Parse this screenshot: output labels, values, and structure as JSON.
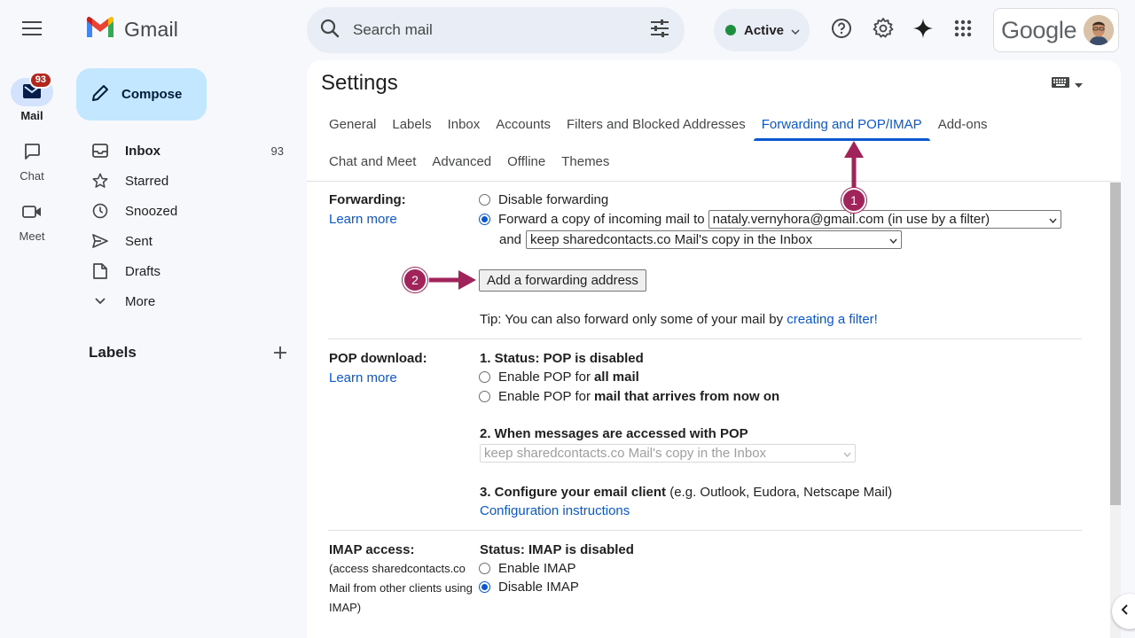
{
  "rail": {
    "items": [
      {
        "label": "Mail",
        "badge": "93"
      },
      {
        "label": "Chat"
      },
      {
        "label": "Meet"
      }
    ]
  },
  "logo": {
    "text": "Gmail"
  },
  "search": {
    "placeholder": "Search mail"
  },
  "status": {
    "label": "Active",
    "color": "#1e8e3e"
  },
  "account": {
    "brand": "Google"
  },
  "compose": {
    "label": "Compose"
  },
  "nav": {
    "items": [
      {
        "label": "Inbox",
        "count": "93",
        "icon": "inbox-icon"
      },
      {
        "label": "Starred",
        "count": "",
        "icon": "star-icon"
      },
      {
        "label": "Snoozed",
        "count": "",
        "icon": "clock-icon"
      },
      {
        "label": "Sent",
        "count": "",
        "icon": "send-icon"
      },
      {
        "label": "Drafts",
        "count": "",
        "icon": "draft-icon"
      },
      {
        "label": "More",
        "count": "",
        "icon": "chevron-down-icon"
      }
    ]
  },
  "labels": {
    "title": "Labels"
  },
  "settings": {
    "title": "Settings",
    "tabs_row1": [
      "General",
      "Labels",
      "Inbox",
      "Accounts",
      "Filters and Blocked Addresses",
      "Forwarding and POP/IMAP",
      "Add-ons"
    ],
    "tabs_row2": [
      "Chat and Meet",
      "Advanced",
      "Offline",
      "Themes"
    ],
    "active_tab": "Forwarding and POP/IMAP",
    "forwarding": {
      "label": "Forwarding:",
      "learn_more": "Learn more",
      "disable_option": "Disable forwarding",
      "forward_option": "Forward a copy of incoming mail to",
      "forward_address": "nataly.vernyhora@gmail.com (in use by a filter)",
      "and_label": "and",
      "copy_action": "keep sharedcontacts.co Mail's copy in the Inbox",
      "add_button": "Add a forwarding address",
      "tip_prefix": "Tip: You can also forward only some of your mail by",
      "tip_link": "creating a filter!"
    },
    "pop": {
      "label": "POP download:",
      "learn_more": "Learn more",
      "status": "1. Status: POP is disabled",
      "opt1_prefix": "Enable POP for",
      "opt1_bold": "all mail",
      "opt2_prefix": "Enable POP for",
      "opt2_bold": "mail that arrives from now on",
      "when_heading": "2. When messages are accessed with POP",
      "when_select": "keep sharedcontacts.co Mail's copy in the Inbox",
      "configure_bold": "3. Configure your email client",
      "configure_rest": "(e.g. Outlook, Eudora, Netscape Mail)",
      "config_link": "Configuration instructions"
    },
    "imap": {
      "label": "IMAP access:",
      "desc": "(access sharedcontacts.co Mail from other clients using IMAP)",
      "status": "Status: IMAP is disabled",
      "enable": "Enable IMAP",
      "disable": "Disable IMAP"
    }
  },
  "annotations": [
    {
      "number": "1",
      "color": "#a0245a"
    },
    {
      "number": "2",
      "color": "#a0245a"
    }
  ]
}
